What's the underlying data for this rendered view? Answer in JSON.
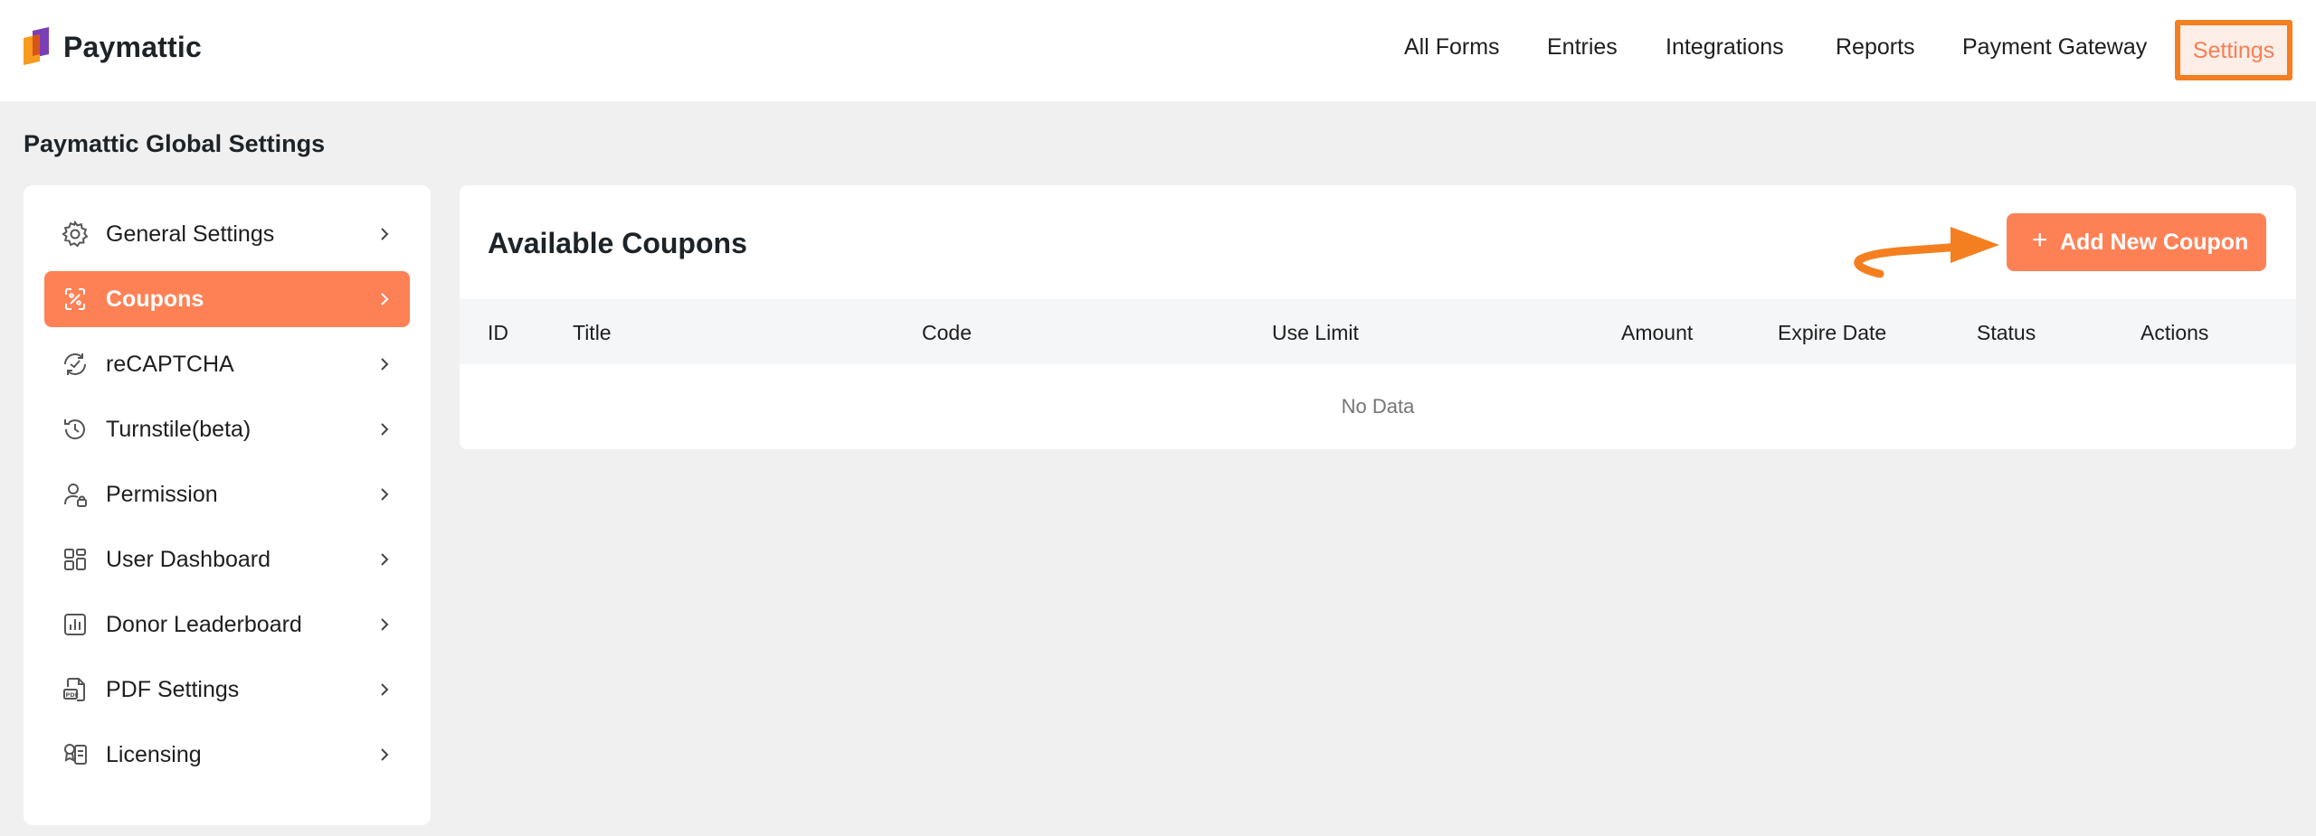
{
  "brand": {
    "name": "Paymattic",
    "colors": {
      "primary": "#5b2d8e",
      "accent": "#f89a1c"
    }
  },
  "nav": [
    {
      "label": "All Forms",
      "name": "nav-all-forms"
    },
    {
      "label": "Entries",
      "name": "nav-entries"
    },
    {
      "label": "Integrations",
      "name": "nav-integrations"
    },
    {
      "label": "Reports",
      "name": "nav-reports"
    },
    {
      "label": "Payment Gateway",
      "name": "nav-payment-gateway"
    }
  ],
  "nav_settings": "Settings",
  "page_title": "Paymattic Global Settings",
  "sidebar": {
    "items": [
      {
        "label": "General Settings",
        "icon": "gear-icon"
      },
      {
        "label": "Coupons",
        "icon": "coupon-icon",
        "active": true
      },
      {
        "label": "reCAPTCHA",
        "icon": "recaptcha-icon"
      },
      {
        "label": "Turnstile(beta)",
        "icon": "history-icon"
      },
      {
        "label": "Permission",
        "icon": "user-lock-icon"
      },
      {
        "label": "User Dashboard",
        "icon": "dashboard-grid-icon"
      },
      {
        "label": "Donor Leaderboard",
        "icon": "bar-chart-icon"
      },
      {
        "label": "PDF Settings",
        "icon": "pdf-icon"
      },
      {
        "label": "Licensing",
        "icon": "license-icon"
      }
    ]
  },
  "main": {
    "title": "Available Coupons",
    "add_button": {
      "plus": "+",
      "label": "Add New Coupon"
    },
    "columns": [
      "ID",
      "Title",
      "Code",
      "Use Limit",
      "Amount",
      "Expire Date",
      "Status",
      "Actions"
    ],
    "empty_text": "No Data"
  },
  "colors": {
    "accent": "#fe8156",
    "highlight": "#f47f20",
    "background": "#f0f0f1"
  }
}
